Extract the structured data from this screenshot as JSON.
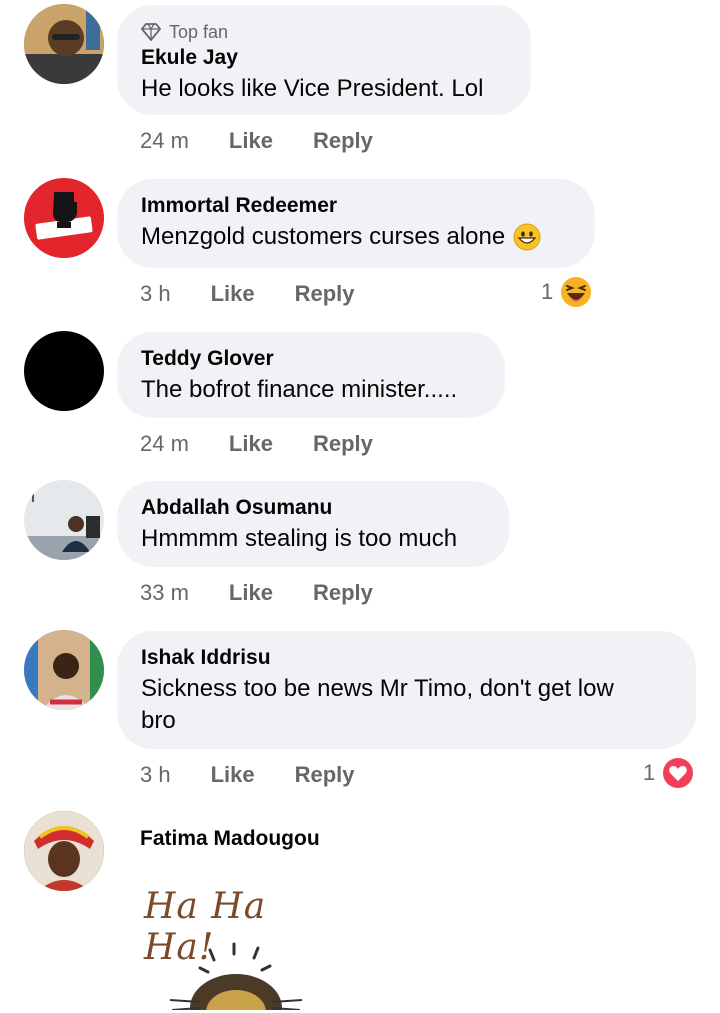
{
  "comments": [
    {
      "badge": "Top fan",
      "name": "Ekule Jay",
      "text": "He looks like Vice President. Lol",
      "time": "24 m",
      "like": "Like",
      "reply": "Reply"
    },
    {
      "name": "Immortal Redeemer",
      "text": "Menzgold customers curses alone",
      "time": "3 h",
      "like": "Like",
      "reply": "Reply",
      "reaction_count": "1",
      "reaction_icon": "haha-icon"
    },
    {
      "name": "Teddy Glover",
      "text": "The bofrot finance minister.....",
      "time": "24 m",
      "like": "Like",
      "reply": "Reply"
    },
    {
      "name": "Abdallah Osumanu",
      "text": "Hmmmm stealing is too much",
      "time": "33 m",
      "like": "Like",
      "reply": "Reply"
    },
    {
      "name": "Ishak Iddrisu",
      "text_line1": "Sickness too be news Mr Timo, don't get low",
      "text_line2": "bro",
      "time": "3 h",
      "like": "Like",
      "reply": "Reply",
      "reaction_count": "1",
      "reaction_icon": "love-icon"
    },
    {
      "name": "Fatima Madougou",
      "gif_text": "Ha Ha Ha!"
    }
  ],
  "colors": {
    "bubble": "#f0f2f5",
    "meta": "#65676b",
    "love": "#f33e58",
    "haha": "#f7b125"
  }
}
